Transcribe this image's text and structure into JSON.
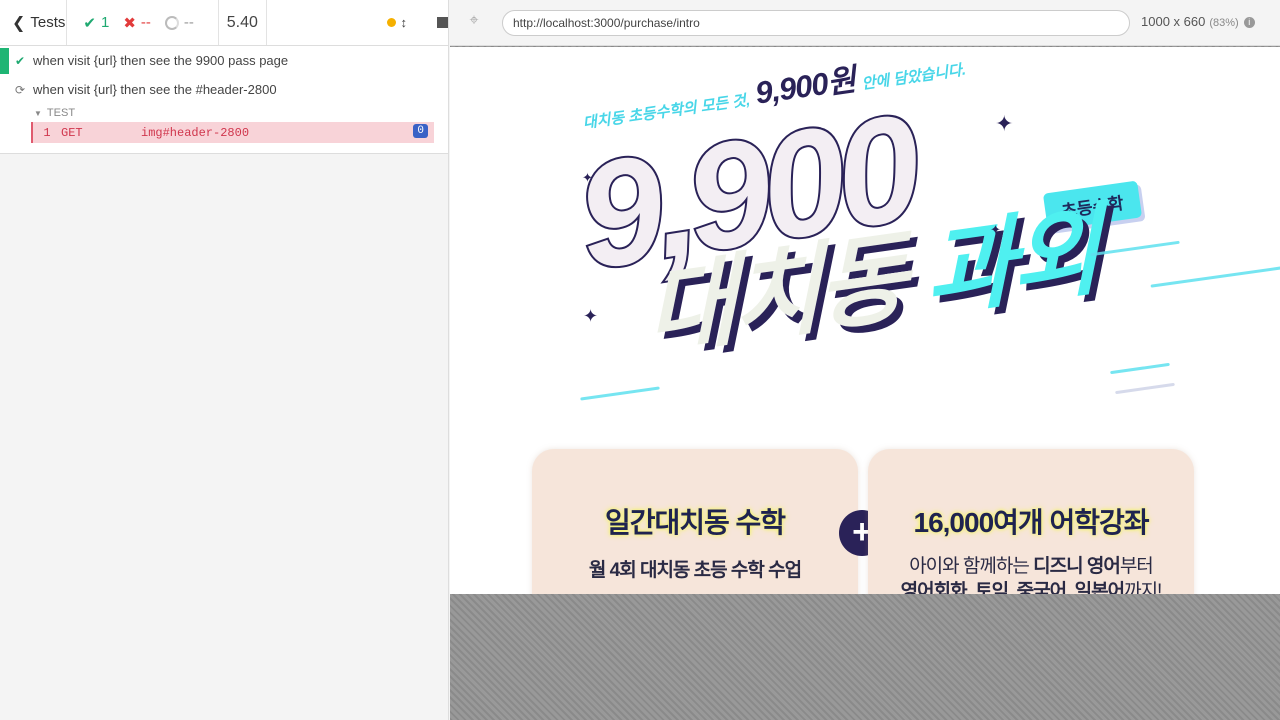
{
  "reporter": {
    "back_label": "Tests",
    "stats": {
      "passed": "1",
      "failed": "--",
      "pending": "--"
    },
    "duration": "5.40"
  },
  "tests": [
    {
      "title": "when visit {url} then see the 9900 pass page",
      "state": "passed"
    },
    {
      "title": "when visit {url} then see the #header-2800",
      "state": "running"
    }
  ],
  "command_group": {
    "label": "TEST",
    "command": {
      "number": "1",
      "method": "GET",
      "selector": "img#header-2800",
      "count": "0"
    }
  },
  "aut": {
    "url": "http://localhost:3000/purchase/intro",
    "viewport": "1000 x 660",
    "scale": "(83%)"
  },
  "page": {
    "tagline_prefix": "대치동 초등수학의 모든 것,",
    "tagline_price": "9,900원",
    "tagline_suffix": "안에 담았습니다.",
    "big_number": "9,900",
    "title_part1": "대치동",
    "title_part2": "과외",
    "subject_badge": "초등수학",
    "card_left": {
      "title": "일간대치동 수학",
      "desc": "월 4회 대치동 초등 수학 수업"
    },
    "card_right": {
      "title": "16,000여개 어학강좌",
      "desc1_a": "아이와 함께하는 ",
      "desc1_b": "디즈니 영어",
      "desc1_c": "부터",
      "desc2_a": "영어회화, 토익, 중국어, 일본어",
      "desc2_b": "까지!"
    },
    "plus": "+"
  },
  "colors": {
    "pass": "#1fa971",
    "fail": "#e23b3b",
    "running_dot": "#f5b000",
    "brand_navy": "#2a2258",
    "brand_cyan": "#4ff0f0",
    "card_bg": "#f6e5da"
  }
}
